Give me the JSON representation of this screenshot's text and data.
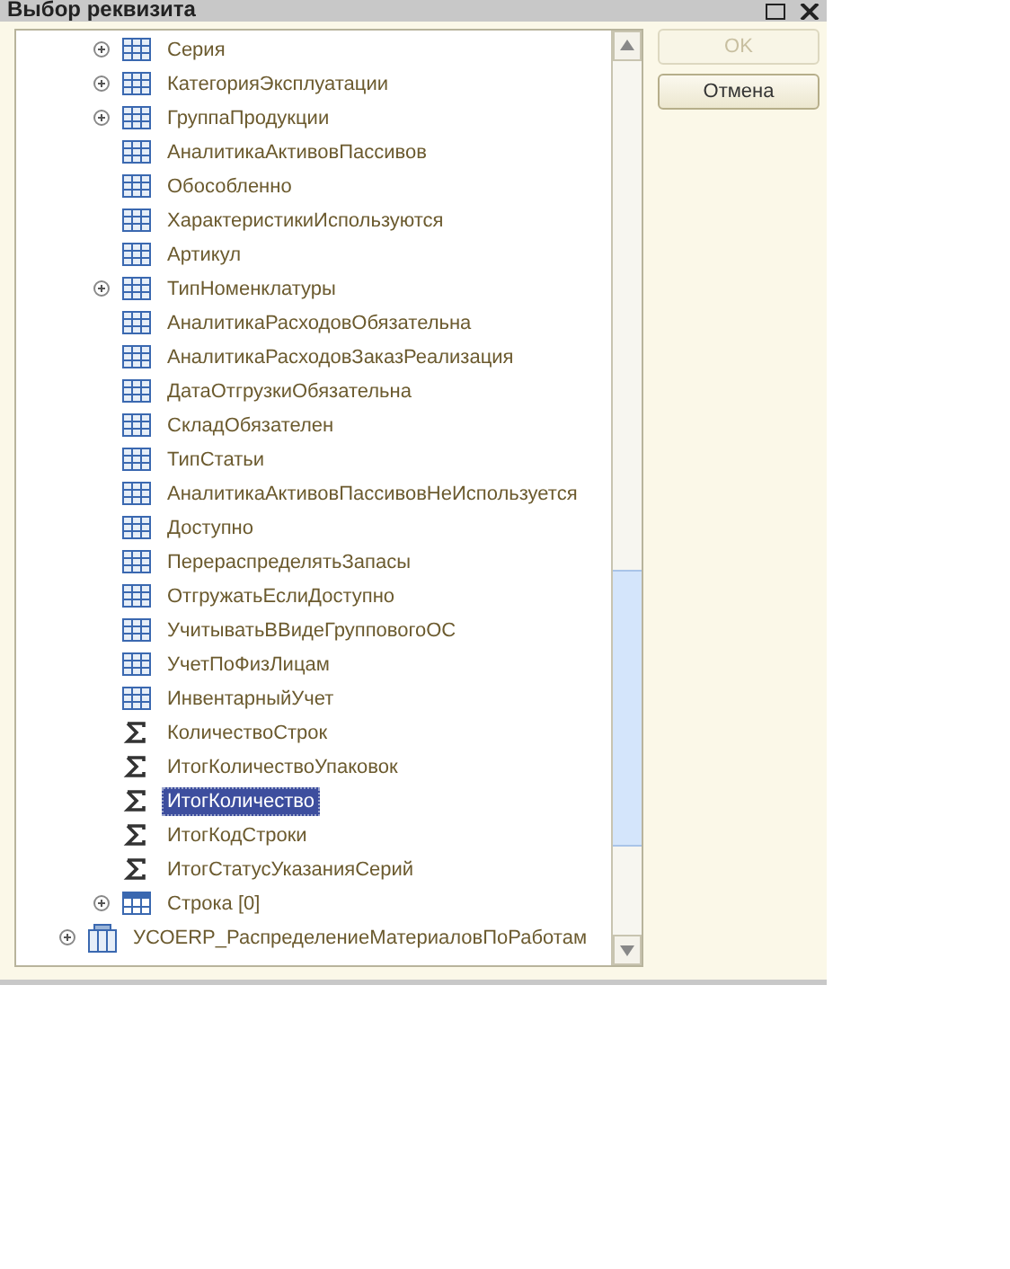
{
  "window": {
    "title": "Выбор реквизита"
  },
  "tree": {
    "items": [
      {
        "children": [
          {
            "label": "Серия",
            "kind": "attribute",
            "expandable": true,
            "selected": false
          },
          {
            "label": "КатегорияЭксплуатации",
            "kind": "attribute",
            "expandable": true,
            "selected": false
          },
          {
            "label": "ГруппаПродукции",
            "kind": "attribute",
            "expandable": true,
            "selected": false
          },
          {
            "label": "АналитикаАктивовПассивов",
            "kind": "attribute",
            "expandable": false,
            "selected": false
          },
          {
            "label": "Обособленно",
            "kind": "attribute",
            "expandable": false,
            "selected": false
          },
          {
            "label": "ХарактеристикиИспользуются",
            "kind": "attribute",
            "expandable": false,
            "selected": false
          },
          {
            "label": "Артикул",
            "kind": "attribute",
            "expandable": false,
            "selected": false
          },
          {
            "label": "ТипНоменклатуры",
            "kind": "attribute",
            "expandable": true,
            "selected": false
          },
          {
            "label": "АналитикаРасходовОбязательна",
            "kind": "attribute",
            "expandable": false,
            "selected": false
          },
          {
            "label": "АналитикаРасходовЗаказРеализация",
            "kind": "attribute",
            "expandable": false,
            "selected": false
          },
          {
            "label": "ДатаОтгрузкиОбязательна",
            "kind": "attribute",
            "expandable": false,
            "selected": false
          },
          {
            "label": "СкладОбязателен",
            "kind": "attribute",
            "expandable": false,
            "selected": false
          },
          {
            "label": "ТипСтатьи",
            "kind": "attribute",
            "expandable": false,
            "selected": false
          },
          {
            "label": "АналитикаАктивовПассивовНеИспользуется",
            "kind": "attribute",
            "expandable": false,
            "selected": false
          },
          {
            "label": "Доступно",
            "kind": "attribute",
            "expandable": false,
            "selected": false
          },
          {
            "label": "ПерераспределятьЗапасы",
            "kind": "attribute",
            "expandable": false,
            "selected": false
          },
          {
            "label": "ОтгружатьЕслиДоступно",
            "kind": "attribute",
            "expandable": false,
            "selected": false
          },
          {
            "label": "УчитыватьВВидеГрупповогоОС",
            "kind": "attribute",
            "expandable": false,
            "selected": false
          },
          {
            "label": "УчетПоФизЛицам",
            "kind": "attribute",
            "expandable": false,
            "selected": false
          },
          {
            "label": "ИнвентарныйУчет",
            "kind": "attribute",
            "expandable": false,
            "selected": false
          },
          {
            "label": "КоличествоСтрок",
            "kind": "total",
            "expandable": false,
            "selected": false
          },
          {
            "label": "ИтогКоличествоУпаковок",
            "kind": "total",
            "expandable": false,
            "selected": false
          },
          {
            "label": "ИтогКоличество",
            "kind": "total",
            "expandable": false,
            "selected": true
          },
          {
            "label": "ИтогКодСтроки",
            "kind": "total",
            "expandable": false,
            "selected": false
          },
          {
            "label": "ИтогСтатусУказанияСерий",
            "kind": "total",
            "expandable": false,
            "selected": false
          },
          {
            "label": "Строка [0]",
            "kind": "tabular",
            "expandable": true,
            "selected": false
          }
        ]
      },
      {
        "label": "УСОERP_РаспределениеМатериаловПоРаботам",
        "kind": "document",
        "expandable": true,
        "selected": false
      }
    ]
  },
  "buttons": [
    {
      "label": "OK",
      "disabled": true
    },
    {
      "label": "Отмена",
      "disabled": false
    }
  ]
}
